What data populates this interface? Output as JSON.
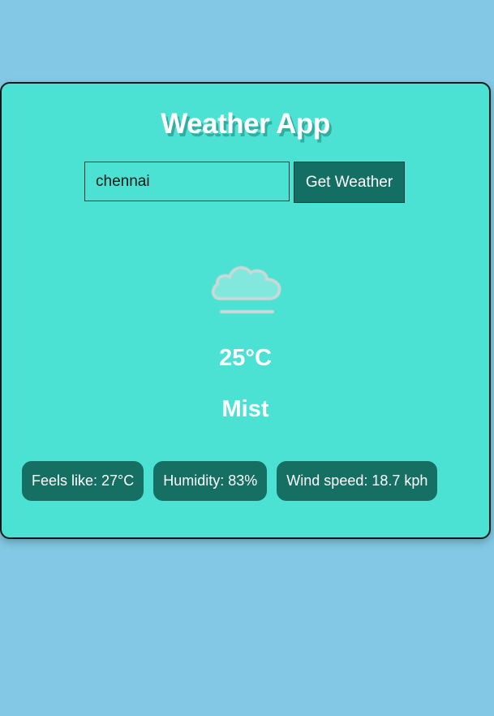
{
  "app": {
    "title": "Weather App"
  },
  "search": {
    "value": "chennai",
    "button_label": "Get Weather"
  },
  "weather": {
    "icon": "mist-icon",
    "temperature": "25°C",
    "condition": "Mist"
  },
  "details": [
    {
      "label": "Feels like: 27°C"
    },
    {
      "label": "Humidity: 83%"
    },
    {
      "label": "Wind speed: 18.7 kph"
    }
  ],
  "colors": {
    "page_background": "#83c9e5",
    "card_background": "#4be1d3",
    "accent_dark": "#136f63",
    "text": "#ffffff"
  }
}
